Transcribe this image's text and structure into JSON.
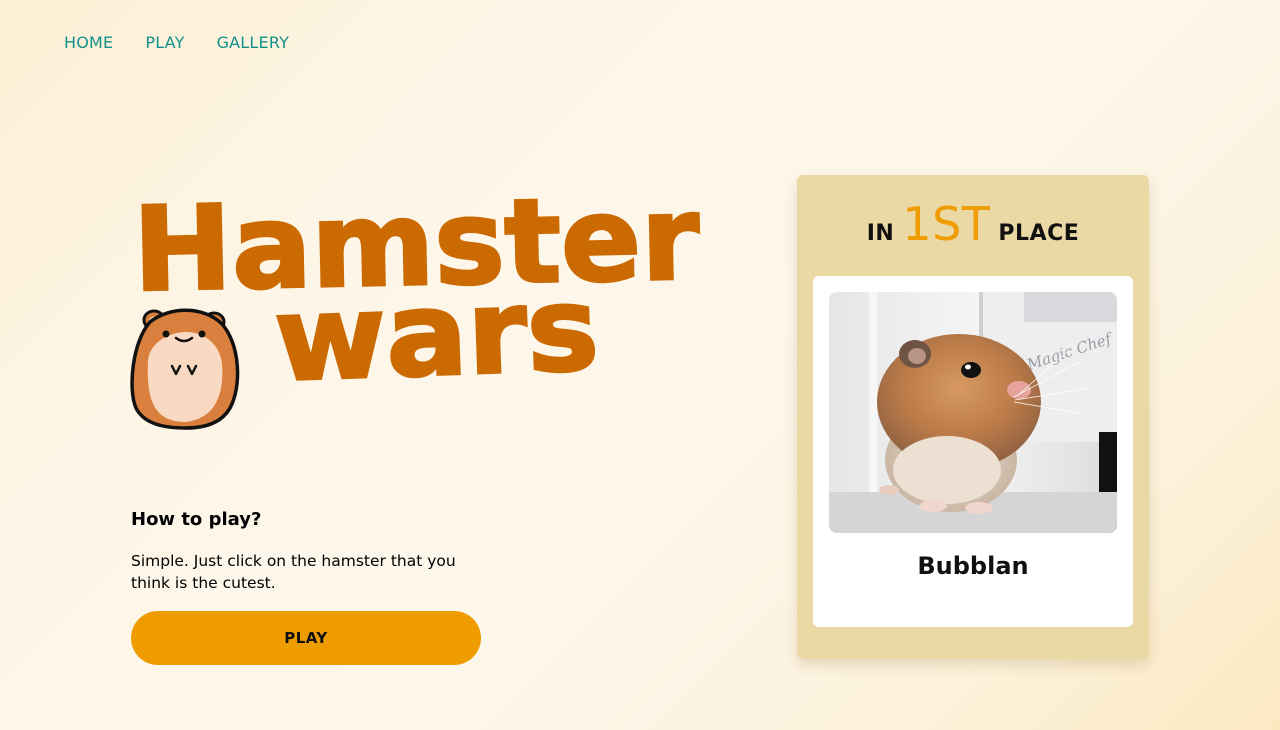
{
  "nav": {
    "items": [
      {
        "label": "HOME"
      },
      {
        "label": "PLAY"
      },
      {
        "label": "GALLERY"
      }
    ]
  },
  "hero": {
    "title_line1": "Hamster",
    "title_line2": "wars",
    "logo_icon": "hamster-mascot-icon"
  },
  "howto": {
    "heading": "How to play?",
    "text": "Simple. Just click on the hamster that you think is the cutest.",
    "button_label": "PLAY"
  },
  "leader": {
    "prefix": "IN",
    "rank": "1ST",
    "suffix": "PLACE",
    "name": "Bubblan",
    "photo_label": "Magic Chef"
  },
  "colors": {
    "title": "#cc6a02",
    "accent": "#ef9c00",
    "nav": "#12918a",
    "panel": "#ead8a5"
  }
}
